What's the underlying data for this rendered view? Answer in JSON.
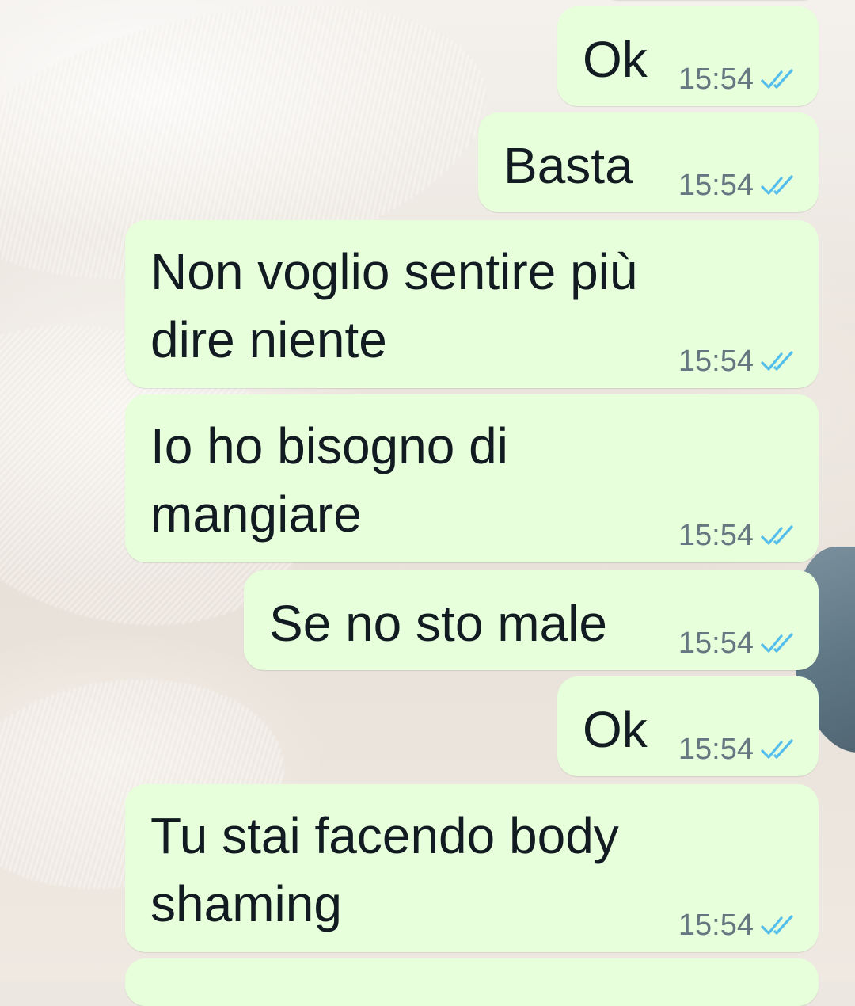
{
  "colors": {
    "outgoing_bubble": "#e7ffdb",
    "message_text": "#111b21",
    "timestamp": "#667781",
    "read_ticks": "#53bdeb"
  },
  "messages": [
    {
      "text": "Ok",
      "time": "15:54",
      "status_icon": "double-check-read-icon"
    },
    {
      "text": "Basta",
      "time": "15:54",
      "status_icon": "double-check-read-icon"
    },
    {
      "text": "Non voglio sentire più\ndire niente",
      "time": "15:54",
      "status_icon": "double-check-read-icon"
    },
    {
      "text": "Io ho bisogno di\nmangiare",
      "time": "15:54",
      "status_icon": "double-check-read-icon"
    },
    {
      "text": "Se no sto male",
      "time": "15:54",
      "status_icon": "double-check-read-icon"
    },
    {
      "text": "Ok",
      "time": "15:54",
      "status_icon": "double-check-read-icon"
    },
    {
      "text": "Tu stai facendo body\nshaming",
      "time": "15:54",
      "status_icon": "double-check-read-icon"
    }
  ]
}
